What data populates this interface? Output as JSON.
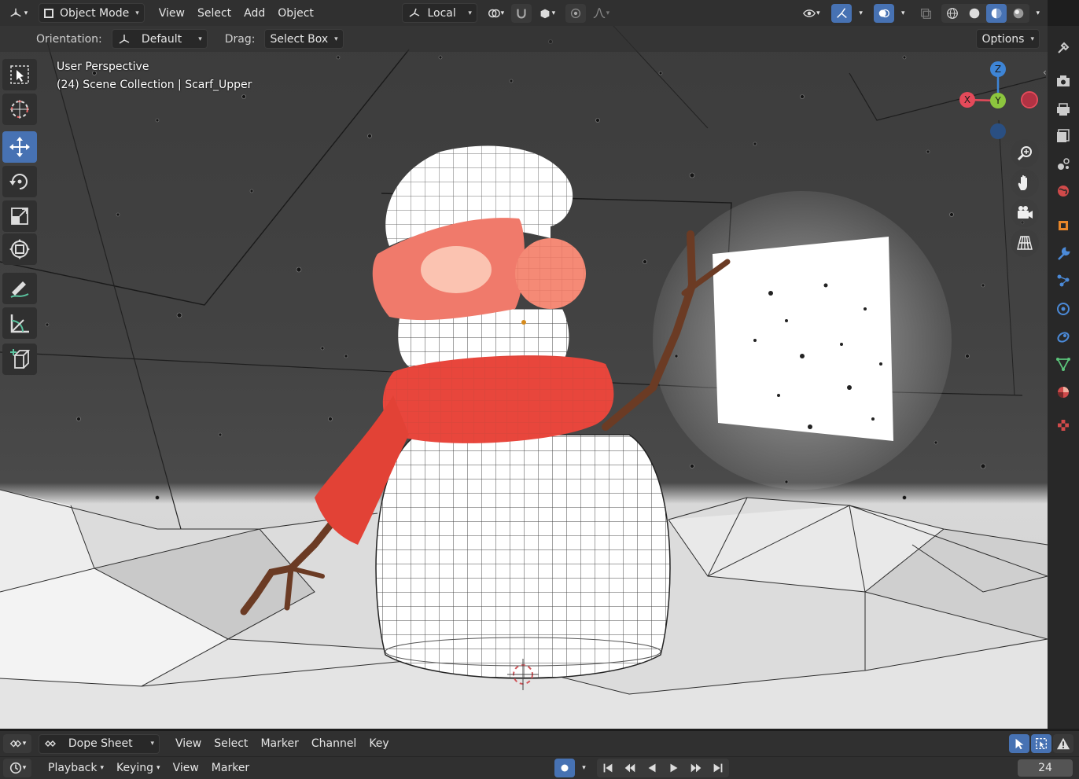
{
  "header": {
    "mode": "Object Mode",
    "menus": [
      "View",
      "Select",
      "Add",
      "Object"
    ],
    "transform_orientation": "Local",
    "options_label": "Options"
  },
  "tool_settings": {
    "orientation_label": "Orientation:",
    "orientation_value": "Default",
    "drag_label": "Drag:",
    "drag_value": "Select Box"
  },
  "viewport": {
    "view_name": "User Perspective",
    "scene_info": "(24) Scene Collection | Scarf_Upper",
    "gizmo_axes": [
      "Z",
      "Y",
      "X"
    ]
  },
  "left_toolbar": [
    "select-box-tool",
    "cursor-tool",
    "move-tool",
    "rotate-tool",
    "scale-tool",
    "transform-tool",
    "annotate-tool",
    "measure-tool",
    "add-cube-tool"
  ],
  "properties_tabs": [
    "tool-tab",
    "render-tab",
    "output-tab",
    "view-layer-tab",
    "scene-tab",
    "world-tab",
    "object-tab",
    "modifier-tab",
    "particles-tab",
    "physics-tab",
    "constraints-tab",
    "data-tab",
    "material-tab",
    "texture-tab"
  ],
  "dope_sheet": {
    "editor": "Dope Sheet",
    "menus": [
      "View",
      "Select",
      "Marker",
      "Channel",
      "Key"
    ]
  },
  "timeline": {
    "playback_label": "Playback",
    "keying_label": "Keying",
    "menus": [
      "View",
      "Marker"
    ],
    "current_frame": "24"
  },
  "colors": {
    "accent": "#4772b3",
    "scarf": "#e8463c",
    "axis_x": "#e54a5a",
    "axis_y": "#8cc63e",
    "axis_z": "#3e85d6"
  }
}
